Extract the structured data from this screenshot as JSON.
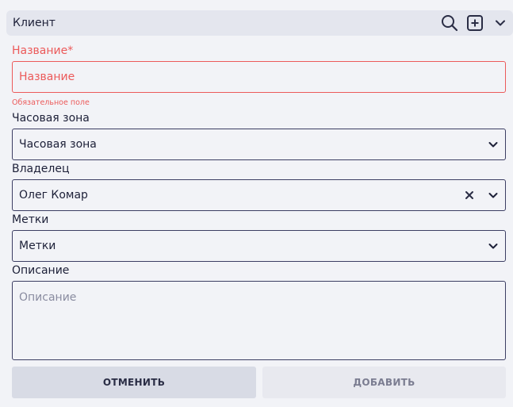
{
  "header": {
    "title": "Клиент"
  },
  "fields": {
    "name": {
      "label": "Название*",
      "placeholder": "Название",
      "hint": "Обязательное поле"
    },
    "timezone": {
      "label": "Часовая зона",
      "value": "Часовая зона"
    },
    "owner": {
      "label": "Владелец",
      "value": "Олег Комар"
    },
    "tags": {
      "label": "Метки",
      "value": "Метки"
    },
    "description": {
      "label": "Описание",
      "placeholder": "Описание"
    }
  },
  "buttons": {
    "cancel": "ОТМЕНИТЬ",
    "add": "ДОБАВИТЬ"
  },
  "colors": {
    "error": "#ec5a5a",
    "border": "#3c3e63",
    "background": "#f2f3f7"
  }
}
